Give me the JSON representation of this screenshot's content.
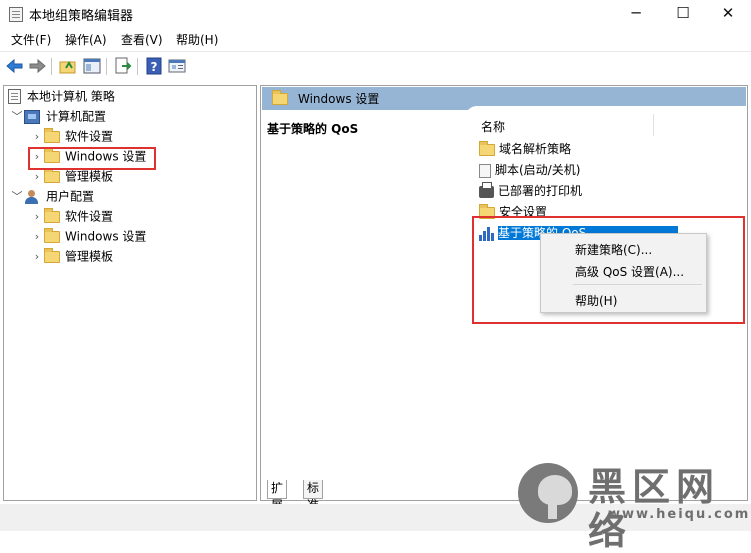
{
  "window": {
    "title": "本地组策略编辑器",
    "minimize_glyph": "─",
    "maximize_glyph": "☐",
    "close_glyph": "✕"
  },
  "menu": [
    "文件(F)",
    "操作(A)",
    "查看(V)",
    "帮助(H)"
  ],
  "toolbar_icons": [
    "back-icon",
    "forward-icon",
    "up-folder-icon",
    "show-hide-tree-icon",
    "export-list-icon",
    "help-icon",
    "properties-icon"
  ],
  "tree": {
    "root": "本地计算机 策略",
    "computer": "计算机配置",
    "computer_children": [
      "软件设置",
      "Windows 设置",
      "管理模板"
    ],
    "user": "用户配置",
    "user_children": [
      "软件设置",
      "Windows 设置",
      "管理模板"
    ]
  },
  "right": {
    "header": "Windows 设置",
    "description_title": "基于策略的 QoS",
    "column_name": "名称",
    "items": [
      "域名解析策略",
      "脚本(启动/关机)",
      "已部署的打印机",
      "安全设置",
      "基于策略的 QoS"
    ]
  },
  "context_menu": {
    "new_policy": "新建策略(C)...",
    "advanced_qos": "高级 QoS 设置(A)...",
    "help": "帮助(H)"
  },
  "tabs": [
    "扩展",
    "标准"
  ],
  "watermark": {
    "title": "黑区网络",
    "url": "www.heiqu.com"
  },
  "colors": {
    "selection": "#0078d7",
    "header_band": "#96b5d5",
    "highlight_box": "#e03131"
  }
}
